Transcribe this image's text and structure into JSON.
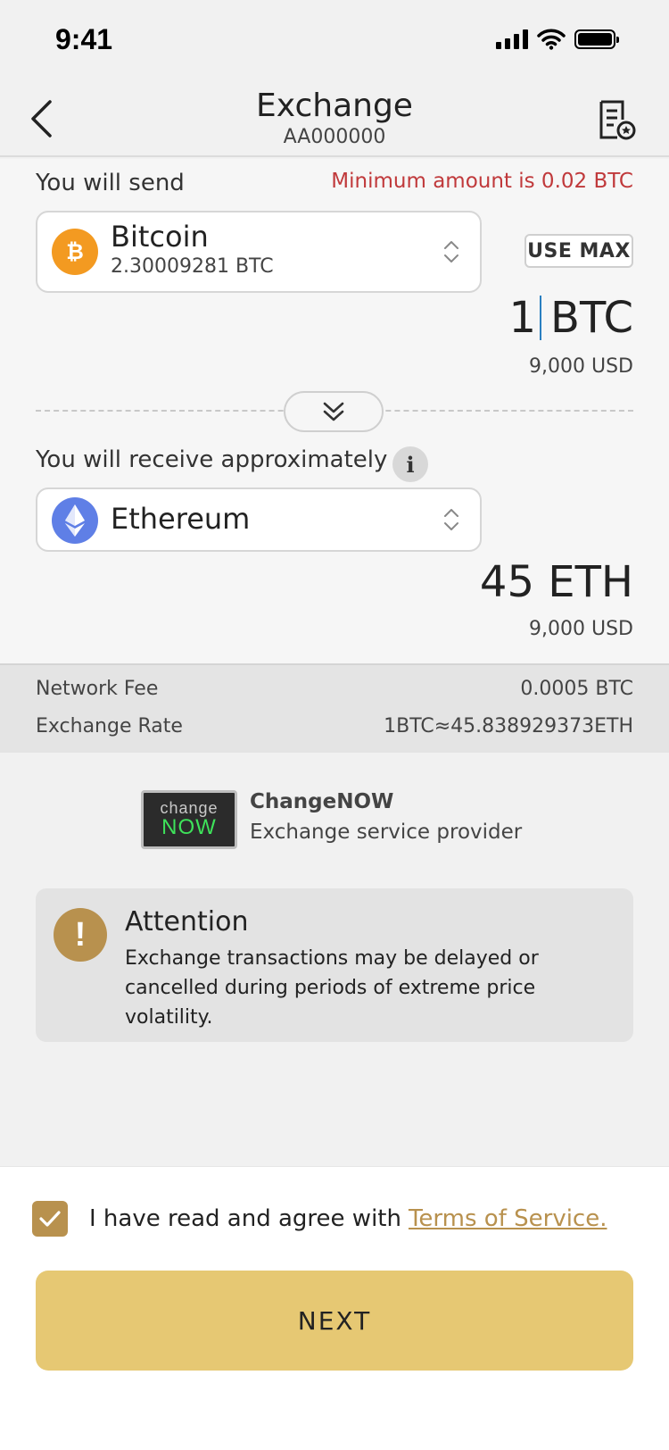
{
  "status_bar": {
    "time": "9:41"
  },
  "nav": {
    "title": "Exchange",
    "subtitle": "AA000000"
  },
  "send": {
    "label": "You will send",
    "minimum_notice": "Minimum amount is 0.02 BTC",
    "asset_name": "Bitcoin",
    "asset_balance": "2.30009281 BTC",
    "use_max_label": "USE MAX",
    "amount_value": "1",
    "amount_unit": "BTC",
    "usd_value": "9,000 USD"
  },
  "receive": {
    "label": "You will receive approximately",
    "info_glyph": "i",
    "asset_name": "Ethereum",
    "amount": "45 ETH",
    "usd_value": "9,000 USD"
  },
  "fees": {
    "network_fee_label": "Network Fee",
    "network_fee_value": "0.0005 BTC",
    "rate_label": "Exchange Rate",
    "rate_value": "1BTC≈45.838929373ETH"
  },
  "provider": {
    "logo_top": "change",
    "logo_bottom": "NOW",
    "name": "ChangeNOW",
    "description": "Exchange service provider"
  },
  "attention": {
    "glyph": "!",
    "title": "Attention",
    "text": "Exchange transactions may be delayed or cancelled during periods of extreme price volatility."
  },
  "agreement": {
    "text": "I have read and agree with",
    "link": "Terms of Service.",
    "checked": true
  },
  "next_label": "NEXT",
  "colors": {
    "accent_gold": "#b8914e",
    "next_button": "#e6c873",
    "warning_red": "#c0393b",
    "bitcoin_orange": "#f39a21",
    "ethereum_blue": "#5f7fe6",
    "changenow_green": "#3ee25a"
  }
}
